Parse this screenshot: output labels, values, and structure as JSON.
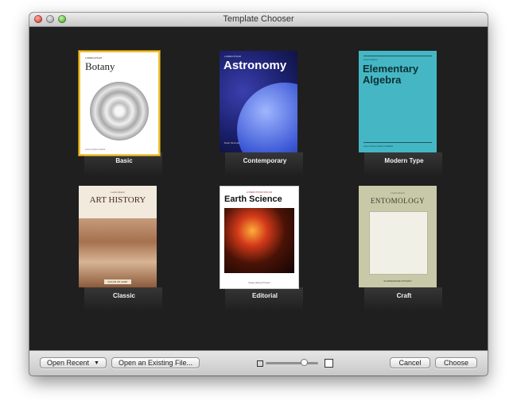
{
  "window": {
    "title": "Template Chooser"
  },
  "templates": [
    {
      "label": "Basic",
      "cover": {
        "small_text": "LOREM IPSUM",
        "title": "Botany",
        "footer": "Lorem Ipsum Dolor"
      }
    },
    {
      "label": "Contemporary",
      "cover": {
        "small_text": "LOREM IPSUM",
        "title": "Astronomy",
        "footer": "Dolor Sit Amet"
      }
    },
    {
      "label": "Modern Type",
      "cover": {
        "small_text": "Lorem Ipsum",
        "title": "Elementary Algebra",
        "footer": "Lorem Ipsum Dolor Facilisis"
      }
    },
    {
      "label": "Classic",
      "cover": {
        "small_text": "Lorem Ipsum",
        "title": "ART HISTORY",
        "footer": "DOLOR SIT AMET"
      }
    },
    {
      "label": "Editorial",
      "cover": {
        "small_text": "LOREM IPSUM DOLOR",
        "title": "Earth Science",
        "footer": "Suspendisse Potenti"
      }
    },
    {
      "label": "Craft",
      "cover": {
        "small_text": "Lorem Ipsum",
        "title": "ENTOMOLOGY",
        "footer": "SUSPENDISSE POTENTI"
      }
    }
  ],
  "bottom": {
    "open_recent": "Open Recent",
    "open_existing": "Open an Existing File...",
    "cancel": "Cancel",
    "choose": "Choose"
  }
}
